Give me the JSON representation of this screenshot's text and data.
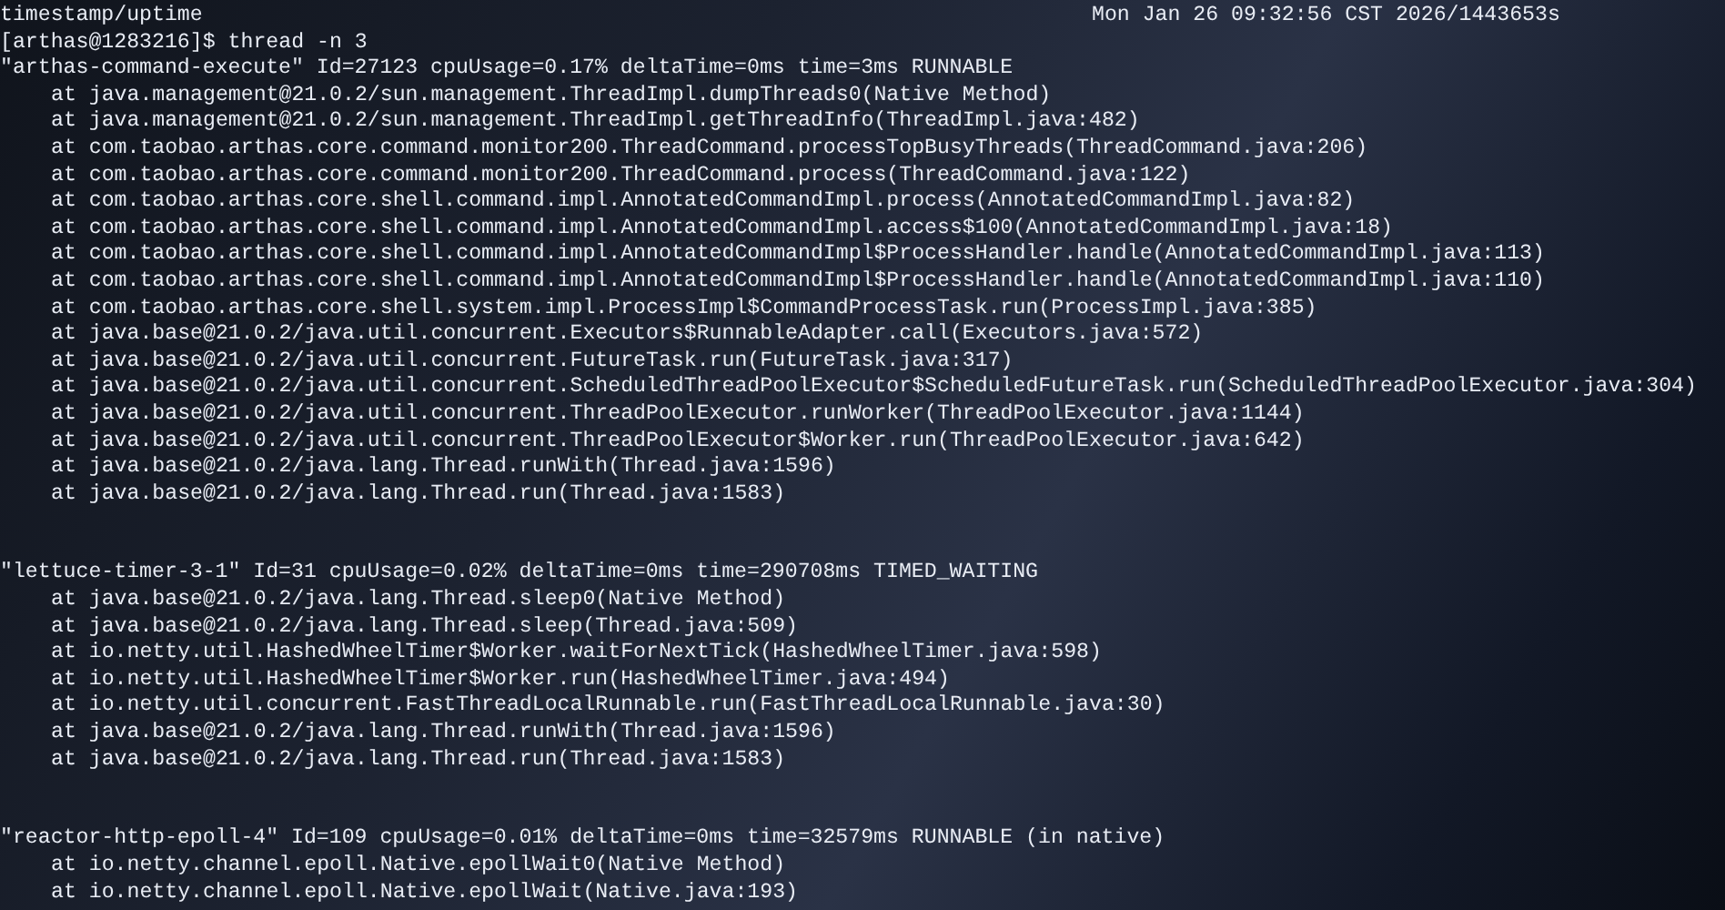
{
  "status_line": {
    "left": "timestamp/uptime",
    "right": "Mon Jan 26 09:32:56 CST 2026/1443653s"
  },
  "prompt": {
    "user_host": "[arthas@1283216]$",
    "command": "thread -n 3"
  },
  "threads": [
    {
      "header": "\"arthas-command-execute\" Id=27123 cpuUsage=0.17% deltaTime=0ms time=3ms RUNNABLE",
      "frames": [
        "at java.management@21.0.2/sun.management.ThreadImpl.dumpThreads0(Native Method)",
        "at java.management@21.0.2/sun.management.ThreadImpl.getThreadInfo(ThreadImpl.java:482)",
        "at com.taobao.arthas.core.command.monitor200.ThreadCommand.processTopBusyThreads(ThreadCommand.java:206)",
        "at com.taobao.arthas.core.command.monitor200.ThreadCommand.process(ThreadCommand.java:122)",
        "at com.taobao.arthas.core.shell.command.impl.AnnotatedCommandImpl.process(AnnotatedCommandImpl.java:82)",
        "at com.taobao.arthas.core.shell.command.impl.AnnotatedCommandImpl.access$100(AnnotatedCommandImpl.java:18)",
        "at com.taobao.arthas.core.shell.command.impl.AnnotatedCommandImpl$ProcessHandler.handle(AnnotatedCommandImpl.java:113)",
        "at com.taobao.arthas.core.shell.command.impl.AnnotatedCommandImpl$ProcessHandler.handle(AnnotatedCommandImpl.java:110)",
        "at com.taobao.arthas.core.shell.system.impl.ProcessImpl$CommandProcessTask.run(ProcessImpl.java:385)",
        "at java.base@21.0.2/java.util.concurrent.Executors$RunnableAdapter.call(Executors.java:572)",
        "at java.base@21.0.2/java.util.concurrent.FutureTask.run(FutureTask.java:317)",
        "at java.base@21.0.2/java.util.concurrent.ScheduledThreadPoolExecutor$ScheduledFutureTask.run(ScheduledThreadPoolExecutor.java:304)",
        "at java.base@21.0.2/java.util.concurrent.ThreadPoolExecutor.runWorker(ThreadPoolExecutor.java:1144)",
        "at java.base@21.0.2/java.util.concurrent.ThreadPoolExecutor$Worker.run(ThreadPoolExecutor.java:642)",
        "at java.base@21.0.2/java.lang.Thread.runWith(Thread.java:1596)",
        "at java.base@21.0.2/java.lang.Thread.run(Thread.java:1583)"
      ]
    },
    {
      "header": "\"lettuce-timer-3-1\" Id=31 cpuUsage=0.02% deltaTime=0ms time=290708ms TIMED_WAITING",
      "frames": [
        "at java.base@21.0.2/java.lang.Thread.sleep0(Native Method)",
        "at java.base@21.0.2/java.lang.Thread.sleep(Thread.java:509)",
        "at io.netty.util.HashedWheelTimer$Worker.waitForNextTick(HashedWheelTimer.java:598)",
        "at io.netty.util.HashedWheelTimer$Worker.run(HashedWheelTimer.java:494)",
        "at io.netty.util.concurrent.FastThreadLocalRunnable.run(FastThreadLocalRunnable.java:30)",
        "at java.base@21.0.2/java.lang.Thread.runWith(Thread.java:1596)",
        "at java.base@21.0.2/java.lang.Thread.run(Thread.java:1583)"
      ]
    },
    {
      "header": "\"reactor-http-epoll-4\" Id=109 cpuUsage=0.01% deltaTime=0ms time=32579ms RUNNABLE (in native)",
      "frames": [
        "at io.netty.channel.epoll.Native.epollWait0(Native Method)",
        "at io.netty.channel.epoll.Native.epollWait(Native.java:193)"
      ]
    }
  ]
}
